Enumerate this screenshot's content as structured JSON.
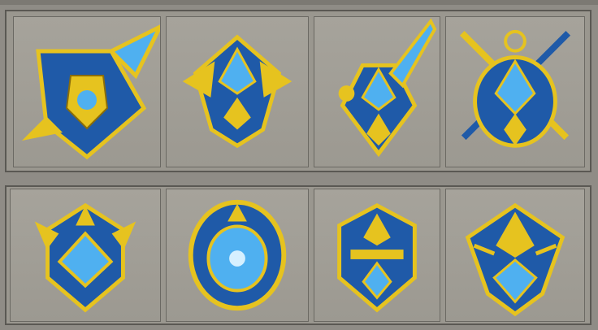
{
  "gallery": {
    "top_row": [
      {
        "icon": "spiked-shield-emblem-icon"
      },
      {
        "icon": "winged-crest-emblem-icon"
      },
      {
        "icon": "sword-crest-emblem-icon"
      },
      {
        "icon": "crossed-swords-crest-emblem-icon"
      }
    ],
    "bottom_row": [
      {
        "icon": "horned-gem-shield-icon"
      },
      {
        "icon": "round-gem-shield-icon"
      },
      {
        "icon": "helm-shield-icon"
      },
      {
        "icon": "kite-shield-icon"
      }
    ],
    "colors": {
      "blue": "#1f5aa8",
      "gold": "#e6c31f",
      "gem": "#4fb0f0",
      "bg": "#9a978f"
    }
  }
}
